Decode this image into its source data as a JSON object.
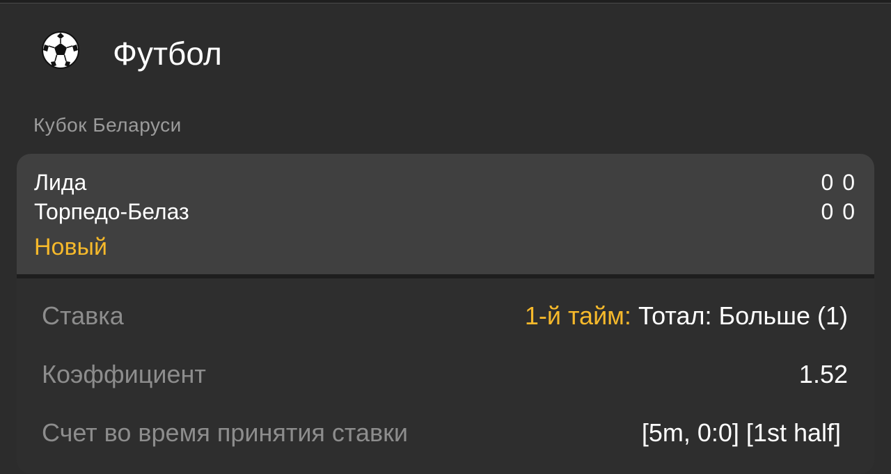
{
  "header": {
    "icon": "soccer-ball-icon",
    "title": "Футбол"
  },
  "league": "Кубок Беларуси",
  "match": {
    "team_home": "Лида",
    "team_away": "Торпедо-Белаз",
    "score_home": "0  0",
    "score_away": "0  0",
    "status": "Новый"
  },
  "details": {
    "bet_label": "Ставка",
    "bet_value_prefix": "1-й тайм:",
    "bet_value": "Тотал: Больше (1)",
    "coef_label": "Коэффициент",
    "coef_value": "1.52",
    "score_label": "Счет во время принятия ставки",
    "score_value": "[5m, 0:0] [1st half]"
  },
  "colors": {
    "background": "#2c2c2c",
    "match_card": "#404040",
    "accent": "#f6b92b",
    "muted_text": "#8d8d8d"
  }
}
